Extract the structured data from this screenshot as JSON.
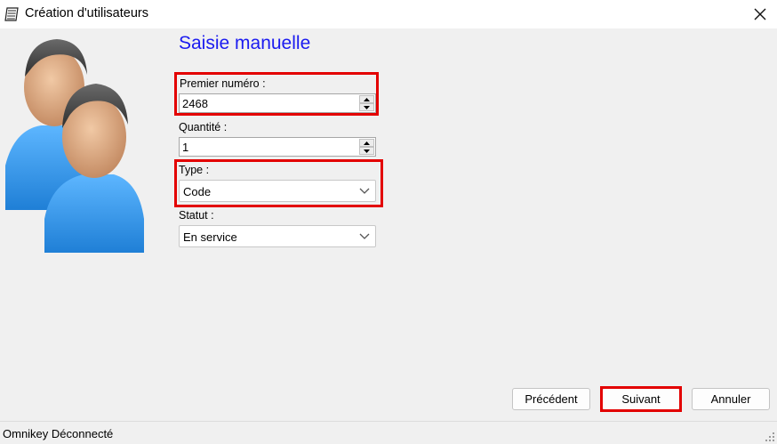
{
  "window": {
    "title": "Création d'utilisateurs",
    "icon": "notepad-icon"
  },
  "heading": "Saisie manuelle",
  "fields": {
    "premier_numero": {
      "label": "Premier numéro :",
      "value": "2468"
    },
    "quantite": {
      "label": "Quantité :",
      "value": "1"
    },
    "type": {
      "label": "Type :",
      "value": "Code"
    },
    "statut": {
      "label": "Statut :",
      "value": "En service"
    }
  },
  "buttons": {
    "previous": "Précédent",
    "next": "Suivant",
    "cancel": "Annuler"
  },
  "status": {
    "text": "Omnikey Déconnecté"
  },
  "colors": {
    "heading": "#1b1bf0",
    "highlight": "#e30000",
    "avatar_shirt": "#3a9ef0"
  }
}
